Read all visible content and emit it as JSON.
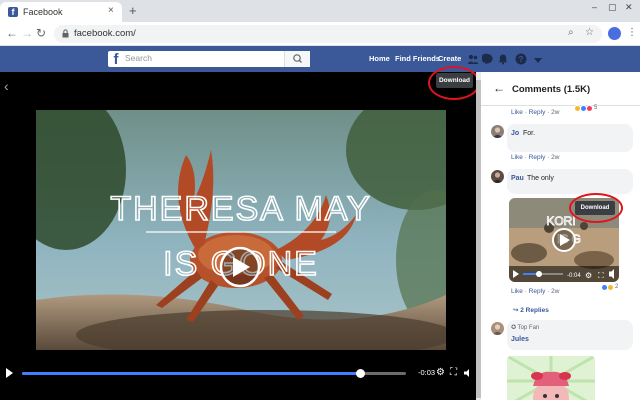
{
  "browser": {
    "tab_title": "Facebook",
    "url": "facebook.com/"
  },
  "header": {
    "search_placeholder": "Search",
    "nav": [
      "Home",
      "Find Friends",
      "Create"
    ]
  },
  "video": {
    "download_label": "Download",
    "overlay_text_line1": "THERESA MAY",
    "overlay_text_line2": "IS GONE",
    "time": "-0:03",
    "progress_fraction": 0.88
  },
  "comments": {
    "title": "Comments (1.5K)",
    "like": "Like",
    "reply": "Reply",
    "sep": "·",
    "age": "2w",
    "first_reaction_count": "5",
    "items": [
      {
        "author": "Jo",
        "text": "For."
      },
      {
        "author": "Pau",
        "text": "The only"
      }
    ],
    "video_reply": {
      "download_label": "Download",
      "overlay_text_line1": "KORI",
      "overlay_text_line2": "IS G",
      "time": "-0:04",
      "reaction_count": "2",
      "replies_label": "2 Replies"
    },
    "top_fan_badge": "Top Fan",
    "third_author": "Jules"
  },
  "colors": {
    "facebook_blue": "#3b5998",
    "highlight_red": "#e0141e",
    "progress_blue": "#4080ff"
  }
}
